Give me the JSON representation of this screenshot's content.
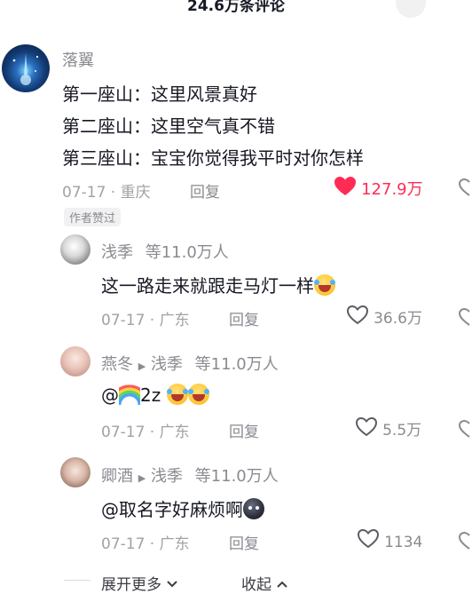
{
  "header": {
    "title": "24.6万条评论",
    "collapse_icon": "collapse-icon"
  },
  "comment": {
    "username": "落翼",
    "lines": [
      "第一座山：这里风景真好",
      "第二座山：这里空气真不错",
      "第三座山：宝宝你觉得我平时对你怎样"
    ],
    "meta": "07-17 · 重庆",
    "reply_label": "回复",
    "likes": "127.9万",
    "liked": true,
    "like_color": "#fe2c55",
    "author_badge": "作者赞过"
  },
  "replies": [
    {
      "username": "浅季",
      "reply_to": "",
      "extra": "等11.0万人",
      "text": "这一路走来就跟走马灯一样",
      "emojis": [
        "laughing-crying-emoji"
      ],
      "meta": "07-17 · 广东",
      "reply_label": "回复",
      "likes": "36.6万"
    },
    {
      "username": "燕冬",
      "reply_to": "浅季",
      "extra": "等11.0万人",
      "text_prefix": "@",
      "text": "2z",
      "emojis": [
        "rainbow-emoji",
        "laughing-crying-emoji",
        "laughing-crying-emoji"
      ],
      "meta": "07-17 · 广东",
      "reply_label": "回复",
      "likes": "5.5万"
    },
    {
      "username": "卿酒",
      "reply_to": "浅季",
      "extra": "等11.0万人",
      "text": "@取名字好麻烦啊",
      "emojis": [
        "dark-face-emoji"
      ],
      "meta": "07-17 · 广东",
      "reply_label": "回复",
      "likes": "1134"
    }
  ],
  "footer": {
    "expand_more": "展开更多",
    "collapse": "收起"
  }
}
